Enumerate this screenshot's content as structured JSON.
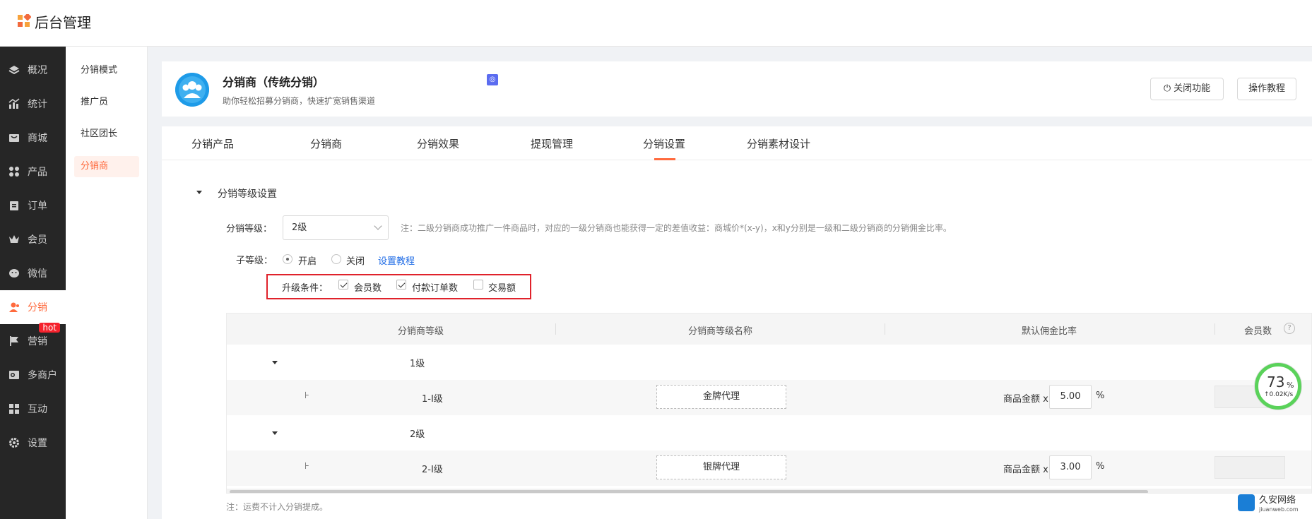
{
  "app": {
    "title": "后台管理"
  },
  "sidebar": {
    "items": [
      {
        "label": "概况",
        "icon": "layers-icon"
      },
      {
        "label": "统计",
        "icon": "chart-icon"
      },
      {
        "label": "商城",
        "icon": "shop-icon"
      },
      {
        "label": "产品",
        "icon": "grid-icon"
      },
      {
        "label": "订单",
        "icon": "order-icon"
      },
      {
        "label": "会员",
        "icon": "crown-icon"
      },
      {
        "label": "微信",
        "icon": "wechat-icon"
      },
      {
        "label": "分销",
        "icon": "user-icon",
        "active": true
      },
      {
        "label": "营销",
        "icon": "flag-icon",
        "badge": "hot"
      },
      {
        "label": "多商户",
        "icon": "store-icon"
      },
      {
        "label": "互动",
        "icon": "puzzle-icon"
      },
      {
        "label": "设置",
        "icon": "gear-icon"
      }
    ]
  },
  "subnav": {
    "items": [
      {
        "label": "分销模式"
      },
      {
        "label": "推广员"
      },
      {
        "label": "社区团长"
      },
      {
        "label": "分销商",
        "active": true
      }
    ]
  },
  "header": {
    "title": "分销商（传统分销）",
    "subtitle": "助你轻松招募分销商，快速扩宽销售渠道",
    "close_button": "关闭功能",
    "tutorial_button": "操作教程"
  },
  "tabs": [
    {
      "label": "分销产品"
    },
    {
      "label": "分销商"
    },
    {
      "label": "分销效果"
    },
    {
      "label": "提现管理"
    },
    {
      "label": "分销设置",
      "active": true
    },
    {
      "label": "分销素材设计"
    }
  ],
  "settings": {
    "section_title": "分销等级设置",
    "level_label": "分销等级：",
    "level_value": "2级",
    "level_note": "注：二级分销商成功推广一件商品时，对应的一级分销商也能获得一定的差值收益：商城价*(x-y)，x和y分别是一级和二级分销商的分销佣金比率。",
    "sublevel_label": "子等级：",
    "sublevel_on": "开启",
    "sublevel_off": "关闭",
    "sublevel_tutorial": "设置教程",
    "upgrade_label": "升级条件：",
    "upgrade_options": [
      {
        "label": "会员数",
        "checked": true
      },
      {
        "label": "付款订单数",
        "checked": true
      },
      {
        "label": "交易额",
        "checked": false
      }
    ]
  },
  "table": {
    "headers": [
      "分销商等级",
      "分销商等级名称",
      "默认佣金比率",
      "会员数"
    ],
    "help_icon": "?",
    "groups": [
      {
        "level": "1级",
        "sub": {
          "mark": "⊦",
          "name": "1-I级",
          "title": "金牌代理",
          "rate_label": "商品金额 x",
          "rate": "5.00",
          "unit": "%"
        }
      },
      {
        "level": "2级",
        "sub": {
          "mark": "⊦",
          "name": "2-I级",
          "title": "银牌代理",
          "rate_label": "商品金额 x",
          "rate": "3.00",
          "unit": "%"
        }
      }
    ]
  },
  "footer_note": "注：运费不计入分销提成。",
  "speed_widget": {
    "value": "73",
    "unit": "%",
    "rate": "↑0.02K/s"
  },
  "watermark": {
    "text": "久安网络",
    "sub": "jiuanweb.com"
  },
  "colors": {
    "accent": "#ff6a3d",
    "sidebar_bg": "#262626",
    "highlight_border": "#e0222b",
    "link": "#1e6be6"
  }
}
